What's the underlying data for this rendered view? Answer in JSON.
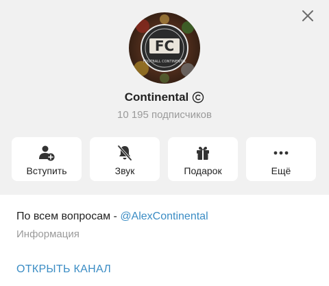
{
  "channel": {
    "name": "Continental",
    "subscribers": "10 195 подписчиков",
    "avatar_text": "FC",
    "avatar_ring_text": "FOOTBALL CONTINENTAL"
  },
  "actions": [
    {
      "label": "Вступить",
      "icon": "user-add-icon"
    },
    {
      "label": "Звук",
      "icon": "bell-muted-icon"
    },
    {
      "label": "Подарок",
      "icon": "gift-icon"
    },
    {
      "label": "Ещё",
      "icon": "more-dots-icon"
    }
  ],
  "info": {
    "description_prefix": "По всем вопросам - ",
    "description_link": "@AlexContinental",
    "description_label": "Информация",
    "open_channel": "ОТКРЫТЬ КАНАЛ"
  },
  "colors": {
    "accent": "#3a8cc4",
    "header_bg": "#f1f1f1",
    "muted_text": "#9a9a9a"
  }
}
